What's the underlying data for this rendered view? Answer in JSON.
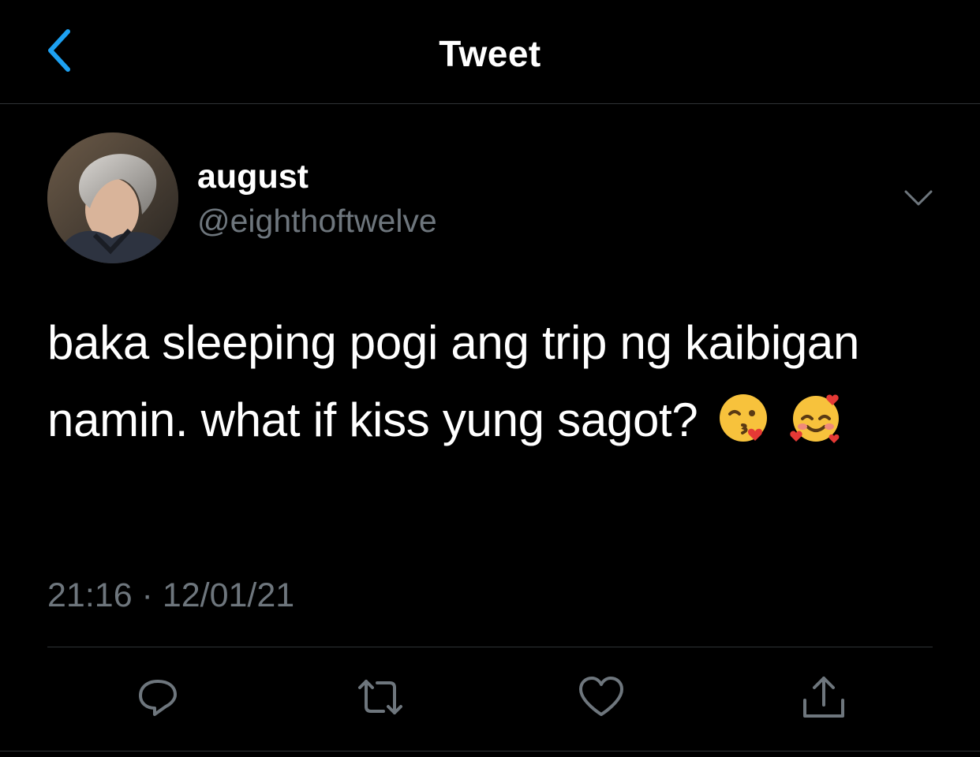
{
  "header": {
    "title": "Tweet",
    "back_icon": "chevron-left-icon",
    "accent_color": "#1da1f2"
  },
  "tweet": {
    "author": {
      "name": "august",
      "handle": "@eighthoftwelve",
      "avatar_icon": "profile-photo"
    },
    "text": "baka sleeping pogi ang trip ng kaibigan namin. what if kiss yung sagot?",
    "emojis": [
      "face-blowing-a-kiss",
      "smiling-face-with-hearts"
    ],
    "timestamp": "21:16 · 12/01/21"
  },
  "actions": [
    {
      "name": "reply",
      "icon": "reply-icon"
    },
    {
      "name": "retweet",
      "icon": "retweet-icon"
    },
    {
      "name": "like",
      "icon": "heart-icon"
    },
    {
      "name": "share",
      "icon": "share-icon"
    }
  ],
  "colors": {
    "background": "#000000",
    "text": "#ffffff",
    "muted": "#6e767d",
    "divider": "#2f3336"
  }
}
